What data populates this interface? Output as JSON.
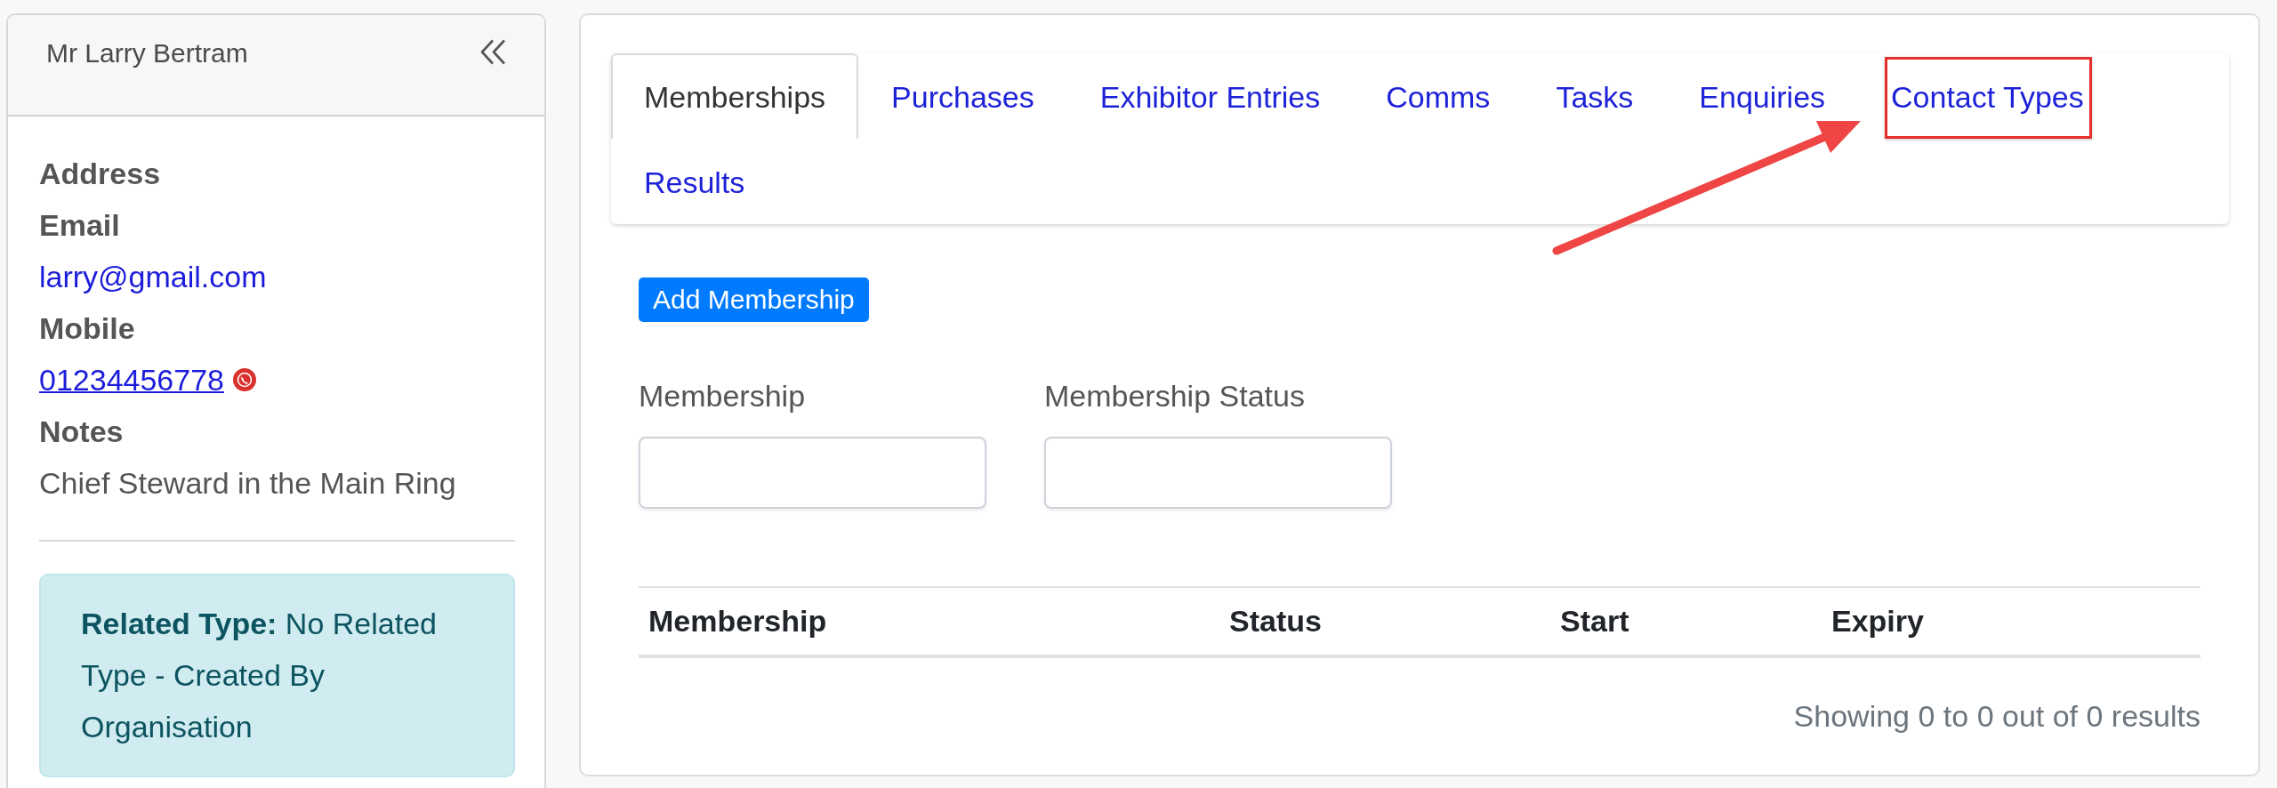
{
  "contact": {
    "title": "Mr Larry Bertram",
    "details": [
      {
        "label": "Address"
      },
      {
        "label": "Email",
        "kind": "email",
        "value": "larry@gmail.com"
      },
      {
        "label": "Mobile",
        "kind": "phone",
        "value": "01234456778"
      },
      {
        "label": "Notes",
        "kind": "text",
        "value": "Chief Steward in the Main Ring"
      }
    ],
    "related_type": "**Related Type:** No Related Type - Created By Organisation"
  },
  "tabs": [
    {
      "label": "Memberships",
      "selected": true,
      "highlighted": false
    },
    {
      "label": "Purchases",
      "selected": false,
      "highlighted": false
    },
    {
      "label": "Exhibitor Entries",
      "selected": false,
      "highlighted": false
    },
    {
      "label": "Comms",
      "selected": false,
      "highlighted": false
    },
    {
      "label": "Tasks",
      "selected": false,
      "highlighted": false
    },
    {
      "label": "Enquiries",
      "selected": false,
      "highlighted": false
    },
    {
      "label": "Contact Types",
      "selected": false,
      "highlighted": true
    },
    {
      "label": "Results",
      "selected": false,
      "highlighted": false
    }
  ],
  "add_button": "Add Membership",
  "filters": [
    {
      "label": "Membership"
    },
    {
      "label": "Membership Status"
    }
  ],
  "table": {
    "columns": [
      "Membership",
      "Status",
      "Start",
      "Expiry"
    ],
    "summary": "Showing 0 to 0 out of 0 results"
  }
}
